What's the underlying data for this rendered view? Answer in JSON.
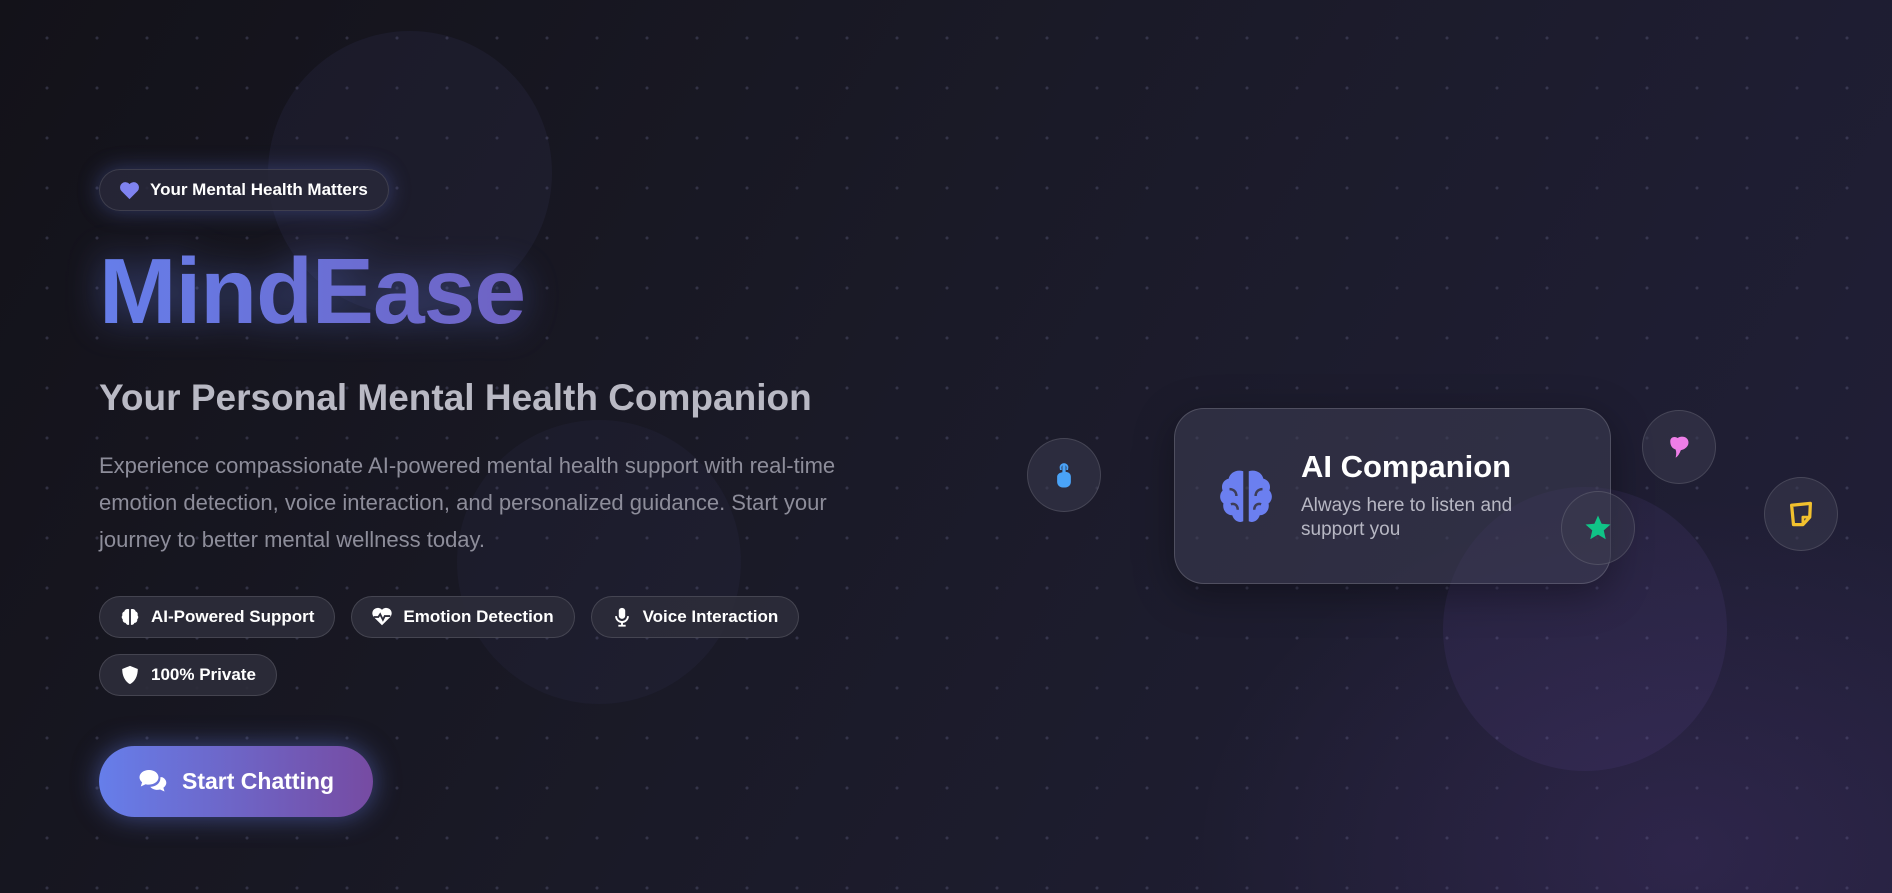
{
  "hero": {
    "badge": {
      "label": "Your Mental Health Matters",
      "icon": "heart-icon",
      "icon_color": "#7f83f0"
    },
    "brand_name": "MindEase",
    "subtitle": "Your Personal Mental Health Companion",
    "description": "Experience compassionate AI-powered mental health support with real-time emotion detection, voice interaction, and personalized guidance. Start your journey to better mental wellness today.",
    "features": [
      {
        "label": "AI-Powered Support",
        "icon": "brain-icon"
      },
      {
        "label": "Emotion Detection",
        "icon": "heart-pulse-icon"
      },
      {
        "label": "Voice Interaction",
        "icon": "microphone-icon"
      },
      {
        "label": "100% Private",
        "icon": "shield-icon"
      }
    ],
    "cta": {
      "label": "Start Chatting",
      "icon": "comments-icon"
    }
  },
  "companion_card": {
    "title": "AI Companion",
    "description": "Always here to listen and support you",
    "icon": "brain-icon",
    "icon_color": "#6b7ff0"
  },
  "floating_icons": [
    {
      "icon": "hand-pointer-icon",
      "color": "#4aa3f7"
    },
    {
      "icon": "heart-blob-icon",
      "color": "#ee7ee8"
    },
    {
      "icon": "star-icon",
      "color": "#10c487"
    },
    {
      "icon": "sticky-note-icon",
      "color": "#f2c12e"
    }
  ],
  "theme": {
    "accent_start": "#667eea",
    "accent_end": "#764ba2",
    "background": "#1a1a27"
  }
}
